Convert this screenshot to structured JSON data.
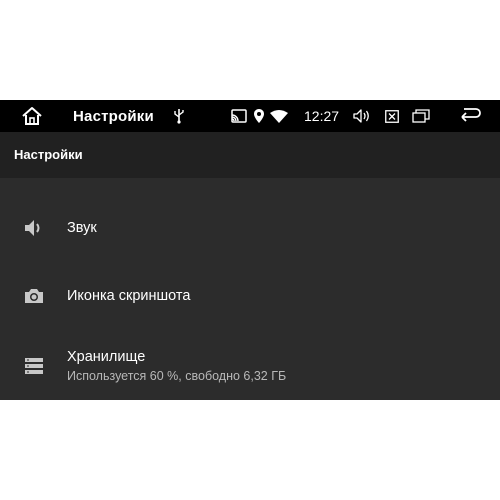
{
  "statusbar": {
    "app_title": "Настройки",
    "time": "12:27"
  },
  "appbar": {
    "title": "Настройки"
  },
  "preferences": [
    {
      "title": "Звук",
      "icon": "volume-icon"
    },
    {
      "title": "Иконка скриншота",
      "icon": "camera-icon"
    },
    {
      "title": "Хранилище",
      "summary": "Используется 60 %, свободно 6,32 ГБ",
      "icon": "storage-icon"
    }
  ],
  "colors": {
    "statusbar_bg": "#000000",
    "appbar_bg": "#212121",
    "content_bg": "#2c2c2c",
    "text_primary": "#ffffff",
    "text_secondary": "#b8b8b8",
    "icon_color": "#c8c8c8"
  }
}
